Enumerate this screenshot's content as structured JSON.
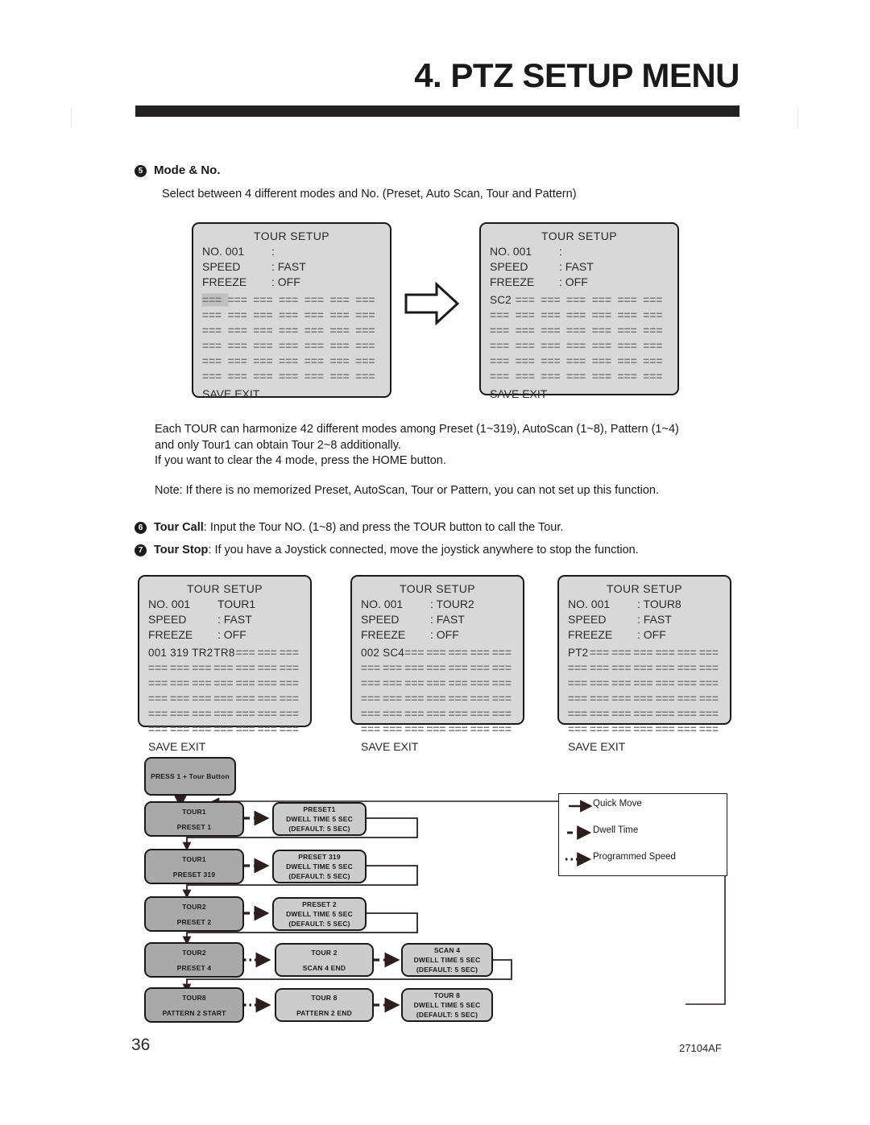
{
  "header": {
    "title": "4. PTZ SETUP MENU"
  },
  "section5": {
    "number": "5",
    "heading": "Mode & No.",
    "subtext": "Select between 4 different modes and No. (Preset, Auto Scan, Tour and Pattern)"
  },
  "osd_common": {
    "title": "TOUR SETUP",
    "label_no": "NO. 001",
    "label_speed": "SPEED",
    "label_freeze": "FREEZE",
    "value_speed": ": FAST",
    "value_freeze": ": OFF",
    "footer": "SAVE EXIT",
    "dashes": "===",
    "colon": ":"
  },
  "osd_panels": [
    {
      "id": "panel-1",
      "title": "TOUR SETUP",
      "no_label": "NO. 001",
      "no_value": ":",
      "speed_label": "SPEED",
      "speed_value": ": FAST",
      "freeze_label": "FREEZE",
      "freeze_value": ": OFF",
      "footer": "SAVE EXIT",
      "selected_index": 0,
      "cells": [
        "===",
        "===",
        "===",
        "===",
        "===",
        "===",
        "===",
        "===",
        "===",
        "===",
        "===",
        "===",
        "===",
        "===",
        "===",
        "===",
        "===",
        "===",
        "===",
        "===",
        "===",
        "===",
        "===",
        "===",
        "===",
        "===",
        "===",
        "===",
        "===",
        "===",
        "===",
        "===",
        "===",
        "===",
        "===",
        "===",
        "===",
        "===",
        "===",
        "===",
        "===",
        "==="
      ]
    },
    {
      "id": "panel-2",
      "title": "TOUR SETUP",
      "no_label": "NO. 001",
      "no_value": ":",
      "speed_label": "SPEED",
      "speed_value": ": FAST",
      "freeze_label": "FREEZE",
      "freeze_value": ": OFF",
      "footer": "SAVE EXIT",
      "selected_index": -1,
      "cells": [
        "SC2",
        "===",
        "===",
        "===",
        "===",
        "===",
        "===",
        "===",
        "===",
        "===",
        "===",
        "===",
        "===",
        "===",
        "===",
        "===",
        "===",
        "===",
        "===",
        "===",
        "===",
        "===",
        "===",
        "===",
        "===",
        "===",
        "===",
        "===",
        "===",
        "===",
        "===",
        "===",
        "===",
        "===",
        "===",
        "===",
        "===",
        "===",
        "===",
        "===",
        "===",
        "==="
      ]
    },
    {
      "id": "panel-3",
      "title": "TOUR SETUP",
      "no_label": "NO. 001",
      "no_value": "TOUR1",
      "speed_label": "SPEED",
      "speed_value": ": FAST",
      "freeze_label": "FREEZE",
      "freeze_value": ": OFF",
      "footer": "SAVE EXIT",
      "selected_index": -1,
      "cells": [
        "001",
        "319",
        "TR2",
        "TR8",
        "===",
        "===",
        "===",
        "===",
        "===",
        "===",
        "===",
        "===",
        "===",
        "===",
        "===",
        "===",
        "===",
        "===",
        "===",
        "===",
        "===",
        "===",
        "===",
        "===",
        "===",
        "===",
        "===",
        "===",
        "===",
        "===",
        "===",
        "===",
        "===",
        "===",
        "===",
        "===",
        "===",
        "===",
        "===",
        "===",
        "===",
        "==="
      ]
    },
    {
      "id": "panel-4",
      "title": "TOUR SETUP",
      "no_label": "NO. 001",
      "no_value": ": TOUR2",
      "speed_label": "SPEED",
      "speed_value": ": FAST",
      "freeze_label": "FREEZE",
      "freeze_value": ": OFF",
      "footer": "SAVE EXIT",
      "selected_index": -1,
      "cells": [
        "002",
        "SC4",
        "===",
        "===",
        "===",
        "===",
        "===",
        "===",
        "===",
        "===",
        "===",
        "===",
        "===",
        "===",
        "===",
        "===",
        "===",
        "===",
        "===",
        "===",
        "===",
        "===",
        "===",
        "===",
        "===",
        "===",
        "===",
        "===",
        "===",
        "===",
        "===",
        "===",
        "===",
        "===",
        "===",
        "===",
        "===",
        "===",
        "===",
        "===",
        "===",
        "==="
      ]
    },
    {
      "id": "panel-5",
      "title": "TOUR SETUP",
      "no_label": "NO. 001",
      "no_value": ": TOUR8",
      "speed_label": "SPEED",
      "speed_value": ": FAST",
      "freeze_label": "FREEZE",
      "freeze_value": ": OFF",
      "footer": "SAVE EXIT",
      "selected_index": -1,
      "cells": [
        "PT2",
        "===",
        "===",
        "===",
        "===",
        "===",
        "===",
        "===",
        "===",
        "===",
        "===",
        "===",
        "===",
        "===",
        "===",
        "===",
        "===",
        "===",
        "===",
        "===",
        "===",
        "===",
        "===",
        "===",
        "===",
        "===",
        "===",
        "===",
        "===",
        "===",
        "===",
        "===",
        "===",
        "===",
        "===",
        "===",
        "===",
        "===",
        "===",
        "===",
        "===",
        "==="
      ]
    }
  ],
  "body": {
    "para1_line1": "Each TOUR can harmonize 42 different modes among Preset (1~319), AutoScan (1~8), Pattern (1~4)",
    "para1_line2": "and only Tour1 can obtain Tour 2~8 additionally.",
    "para1_line3": "If you want to clear the 4 mode, press the HOME button.",
    "note": "Note: If there is no memorized Preset, AutoScan, Tour or Pattern, you can not set up this function."
  },
  "items": [
    {
      "number": "6",
      "label": "Tour Call",
      "text": ": Input the Tour NO. (1~8) and press the TOUR button to call the Tour."
    },
    {
      "number": "7",
      "label": "Tour Stop",
      "text": ": If you have a Joystick connected, move the joystick anywhere to stop the function."
    }
  ],
  "flowchart": {
    "start": "PRESS 1 + Tour Button",
    "rows": [
      {
        "left_top": "TOUR1",
        "left_bottom": "PRESET 1",
        "mid_top": "PRESET1",
        "mid_mid": "DWELL TIME 5 SEC",
        "mid_bottom": "(DEFAULT: 5 SEC)",
        "right_top": "",
        "right_mid": "",
        "right_bottom": "",
        "arrow1": "dashed",
        "arrow2": ""
      },
      {
        "left_top": "TOUR1",
        "left_bottom": "PRESET 319",
        "mid_top": "PRESET 319",
        "mid_mid": "DWELL TIME 5 SEC",
        "mid_bottom": "(DEFAULT: 5 SEC)",
        "right_top": "",
        "right_mid": "",
        "right_bottom": "",
        "arrow1": "dashed",
        "arrow2": ""
      },
      {
        "left_top": "TOUR2",
        "left_bottom": "PRESET 2",
        "mid_top": "PRESET 2",
        "mid_mid": "DWELL TIME 5 SEC",
        "mid_bottom": "(DEFAULT: 5 SEC)",
        "right_top": "",
        "right_mid": "",
        "right_bottom": "",
        "arrow1": "dashed",
        "arrow2": ""
      },
      {
        "left_top": "TOUR2",
        "left_bottom": "PRESET 4",
        "mid_top": "TOUR 2",
        "mid_mid": "",
        "mid_bottom": "SCAN 4 END",
        "right_top": "SCAN 4",
        "right_mid": "DWELL TIME 5 SEC",
        "right_bottom": "(DEFAULT: 5 SEC)",
        "arrow1": "dotted",
        "arrow2": "dashed"
      },
      {
        "left_top": "TOUR8",
        "left_bottom": "PATTERN 2 START",
        "mid_top": "TOUR 8",
        "mid_mid": "",
        "mid_bottom": "PATTERN 2 END",
        "right_top": "TOUR 8",
        "right_mid": "DWELL TIME 5 SEC",
        "right_bottom": "(DEFAULT: 5 SEC)",
        "arrow1": "dotted",
        "arrow2": "dashed"
      }
    ]
  },
  "legend": [
    {
      "style": "solid",
      "label": "Quick Move"
    },
    {
      "style": "dashed",
      "label": "Dwell Time"
    },
    {
      "style": "dotted",
      "label": "Programmed Speed"
    }
  ],
  "footer": {
    "page_number": "36",
    "doc_code": "27104AF"
  },
  "colors": {
    "title_bar": "#232021",
    "osd_bg": "#d8d8d8",
    "flow_dark": "#a9a9a9",
    "flow_light": "#cccccc",
    "ink": "#1a1a1a"
  }
}
